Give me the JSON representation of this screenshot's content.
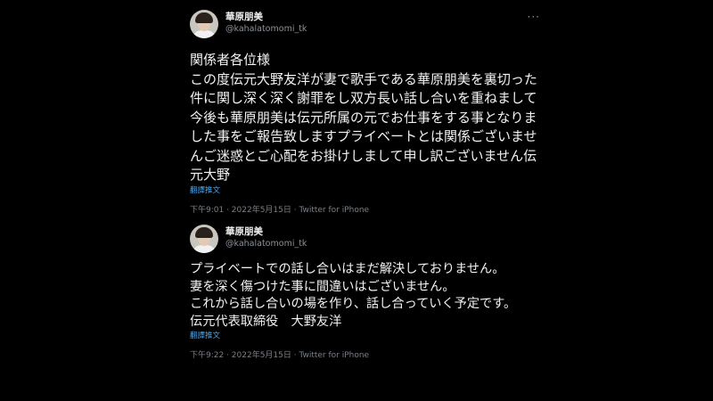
{
  "tweets": [
    {
      "display_name": "華原朋美",
      "handle": "@kahalatomomi_tk",
      "more_label": "···",
      "text": "関係者各位様\nこの度伝元大野友洋が妻で歌手である華原朋美を裏切った件に関し深く深く謝罪をし双方長い話し合いを重ねまして今後も華原朋美は伝元所属の元でお仕事をする事となりました事をご報告致しますプライベートとは関係ございませんご迷惑とご心配をお掛けしまして申し訳ございません伝元大野",
      "translate_label": "翻譯推文",
      "timestamp": "下午9:01 · 2022年5月15日 · Twitter for iPhone",
      "avatar_icon": "profile-photo"
    },
    {
      "display_name": "華原朋美",
      "handle": "@kahalatomomi_tk",
      "more_label": "",
      "text": "プライベートでの話し合いはまだ解決しておりません。\n妻を深く傷つけた事に間違いはございません。\nこれから話し合いの場を作り、話し合っていく予定です。\n伝元代表取締役　大野友洋",
      "translate_label": "翻譯推文",
      "timestamp": "下午9:22 · 2022年5月15日 · Twitter for iPhone",
      "avatar_icon": "profile-photo"
    }
  ],
  "colors": {
    "background": "#000000",
    "text": "#f2f2f2",
    "secondary": "#8b9299",
    "link": "#4aa3e8"
  }
}
